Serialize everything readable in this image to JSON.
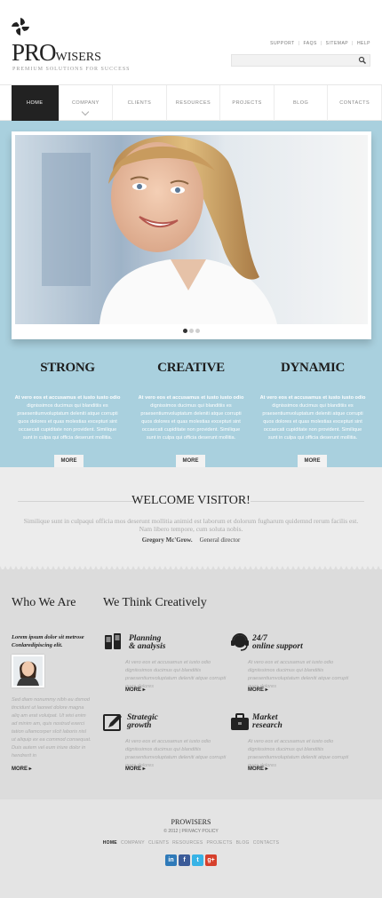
{
  "brand": {
    "pro": "PRO",
    "wisers": "WISERS",
    "tagline": "PREMIUM SOLUTIONS FOR SUCCESS"
  },
  "toplinks": [
    "SUPPORT",
    "FAQS",
    "SITEMAP",
    "HELP"
  ],
  "search": {
    "value": "",
    "placeholder": ""
  },
  "nav": [
    "HOME",
    "COMPANY",
    "CLIENTS",
    "RESOURCES",
    "PROJECTS",
    "BLOG",
    "CONTACTS"
  ],
  "colors": {
    "band": "#a9d0de",
    "nav_active": "#222222"
  },
  "slider": {
    "active_dot": 1,
    "dot_count": 3
  },
  "columns": [
    {
      "title": "STRONG",
      "text": "At vero eos et accusamus et iusto iusto odio dignissimos ducimus qui blanditiis es praesentiumvoluptatum deleniti atque corrupti quos dolores et quas molestias excepturi sint occaecati cupiditate non provident. Similique sunt in culpa qui officia deserunt mollitia.",
      "more": "MORE"
    },
    {
      "title": "CREATIVE",
      "text": "At vero eos et accusamus et iusto iusto odio dignissimos ducimus qui blanditiis es praesentiumvoluptatum deleniti atque corrupti quos dolores et quas molestias excepturi sint occaecati cupiditate non provident. Similique sunt in culpa qui officia deserunt mollitia.",
      "more": "MORE"
    },
    {
      "title": "DYNAMIC",
      "text": "At vero eos et accusamus et iusto iusto odio dignissimos ducimus qui blanditiis es praesentiumvoluptatum deleniti atque corrupti quos dolores et quas molestias excepturi sint occaecati cupiditate non provident. Similique sunt in culpa qui officia deserunt mollitia.",
      "more": "MORE"
    }
  ],
  "welcome": {
    "title": "WELCOME VISITOR!",
    "text": "Similique sunt in culpaqui officia mos deserunt mollitia animid est laborum et dolorum fugharum quidemnd rerum facilis est. Nam libero tempore, cum soluta nobis.",
    "name": "Gregory Mc'Grow.",
    "role": "General director"
  },
  "who": {
    "heading": "Who We Are",
    "subtitle": "Lorem ipsum dolor sit metrose Conlaredipiscing elit.",
    "text": "Sed diam nonummy nibh eu dsmod tincidunt ut laoreet dolore magna aliq am erat volutpat. Ut wisi enim ad minim am, quis nostrud exerci tation ullamcorper sIcit laboris nisl ut aliquip ex ea commod consequat. Duis autem vel eum iriure dolor in hendrerit in",
    "more": "MORE"
  },
  "think": {
    "heading": "We Think Creatively",
    "features": [
      {
        "icon": "phone-icon",
        "title_lines": [
          "Planning",
          "& analysis"
        ],
        "text": "At vero eos et accusamus et iusto odio digniissimos ducimus qui blanditiis praesentiumvoluptatum deleniti atque corrupti quos dolores",
        "more": "MORE"
      },
      {
        "icon": "headset-icon",
        "title_lines": [
          "24/7",
          "online support"
        ],
        "text": "At vero eos et accusamus et iusto odio digniissimos ducimus qui blanditiis praesentiumvoluptatum deleniti atque corrupti quos dolores",
        "more": "MORE"
      },
      {
        "icon": "pencil-icon",
        "title_lines": [
          "Strategic",
          "growth"
        ],
        "text": "At vero eos et accusamus et iusto odio digniissimos ducimus qui blanditiis praesentiumvoluptatum deleniti atque corrupti quos dolores",
        "more": "MORE"
      },
      {
        "icon": "briefcase-icon",
        "title_lines": [
          "Market",
          "research"
        ],
        "text": "At vero eos et accusamus et iusto odio digniissimos ducimus qui blanditiis praesentiumvoluptatum deleniti atque corrupti quos dolores",
        "more": "MORE"
      }
    ]
  },
  "footer": {
    "brand": "PROWISERS",
    "copy": "© 2012",
    "policy": "PRIVACY POLICY",
    "nav": [
      "HOME",
      "COMPANY",
      "CLIENTS",
      "RESOURCES",
      "PROJECTS",
      "BLOG",
      "CONTACTS"
    ],
    "social": [
      {
        "icon": "linkedin-icon",
        "label": "in",
        "color": "#2f7ab9"
      },
      {
        "icon": "facebook-icon",
        "label": "f",
        "color": "#3b5b98"
      },
      {
        "icon": "twitter-icon",
        "label": "t",
        "color": "#37b3e6"
      },
      {
        "icon": "googleplus-icon",
        "label": "g+",
        "color": "#d6402c"
      }
    ]
  }
}
